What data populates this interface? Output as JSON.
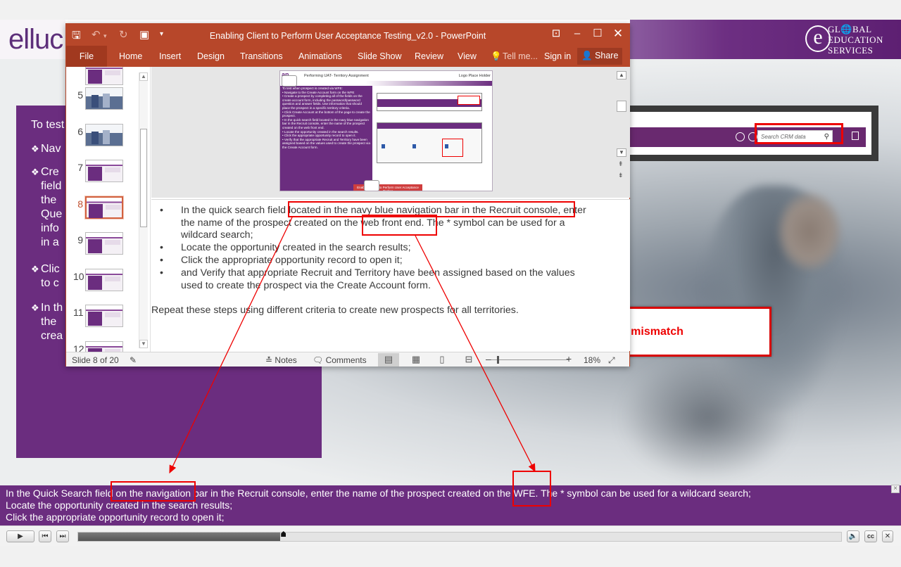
{
  "course": {
    "logo_left": "elluc",
    "logo_right_letter": "e",
    "logo_right_lines": [
      "GL🌐BAL",
      "EDUCATION",
      "SERVICES"
    ],
    "panel": {
      "intro": "To test",
      "bullets": [
        {
          "lines": "Nav"
        },
        {
          "lines": "Cre\nfield\nthe\nQue\ninfo\nin a"
        },
        {
          "lines": "Clic\nto c"
        },
        {
          "lines": "In th\nthe\ncrea"
        }
      ]
    },
    "crm_search_placeholder": "Search CRM data",
    "callout_text": "Plz chk the mismatch",
    "captions": [
      "In the Quick Search field on the navigation bar in the Recruit console, enter the name of the prospect created on the WFE. The * symbol can be used for a wildcard search;",
      "Locate the opportunity created in the search results;",
      "Click the appropriate opportunity record to open it;"
    ],
    "caption_close": "×",
    "progress": 0.265
  },
  "ppt": {
    "title": "Enabling Client to Perform User Acceptance Testing_v2.0 - PowerPoint",
    "menu": [
      "File",
      "Home",
      "Insert",
      "Design",
      "Transitions",
      "Animations",
      "Slide Show",
      "Review",
      "View",
      "Tell me...",
      "Sign in",
      "Share"
    ],
    "thumbnails": [
      {
        "num": "5",
        "kind": "photo"
      },
      {
        "num": "6",
        "kind": "photo"
      },
      {
        "num": "7",
        "kind": "slide"
      },
      {
        "num": "8",
        "kind": "slide",
        "selected": true
      },
      {
        "num": "9",
        "kind": "slide"
      },
      {
        "num": "10",
        "kind": "slide"
      },
      {
        "num": "11",
        "kind": "slide"
      },
      {
        "num": "12",
        "kind": "slide"
      }
    ],
    "slide": {
      "logo": "an",
      "title": "Performing UAT- Territory Assignment",
      "logo_placeholder": "Logo Place Holder",
      "body": [
        "To test when prospect is created via WFE:",
        "• Navigate to the Create Account form on the WFE",
        "• Create a prospect by completing all of the fields on the create account form, including the password/password question and answer fields. Use information that should place the prospect in a specific territory criteria.",
        "• Click Create Account at the bottom of the page to create the prospect.",
        "• In the quick search field located in the navy blue navigation bar in the Recruit console, enter the name of the prospect created on the web front end.",
        "• Locate the opportunity created in the search results.",
        "• Click the appropriate opportunity record to open it.",
        "• Verify that the appropriate Recruit and Territory have been assigned based on the values used to create the prospect via the Create Account form."
      ],
      "footer": "Enabling Client to Perform User Acceptance Testing"
    },
    "notes": {
      "bullets": [
        "In the quick search field located in the navy blue navigation bar in the Recruit console, enter\nthe name of the prospect created on the web front end. The * symbol can be used for a\nwildcard search;",
        "Locate the opportunity created in the search results;",
        "Click the appropriate opportunity record to open it;",
        "and Verify that appropriate Recruit and Territory have been assigned based on the values\nused to create the prospect via the Create Account form."
      ],
      "bullet_char": "•",
      "footer_line": "Repeat these steps using different criteria to create new prospects for all territories."
    },
    "status": {
      "slide_info": "Slide 8 of 20",
      "notes_label": "Notes",
      "comments_label": "Comments",
      "zoom": "18%"
    }
  }
}
